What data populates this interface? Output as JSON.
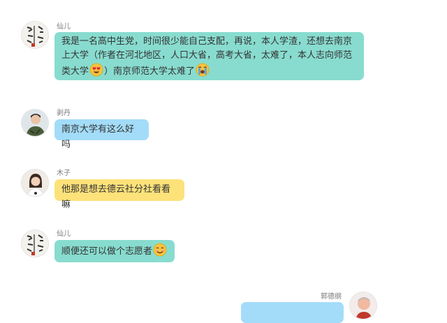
{
  "messages": [
    {
      "user": "仙儿",
      "line1": "我是一名高中生党，时间很少能自己支配，再说，本人学渣，还想去南京",
      "line2": "上大学（作者在河北地区，人口大省，高考大省，太难了，本人志向师范",
      "line3a": "类大学",
      "line3b": "）南京师范大学太难了",
      "emoji_a": "heart-eyes-face",
      "emoji_b": "crying-face",
      "color": "#88dccf"
    },
    {
      "user": "剥丹",
      "text": "南京大学有这么好吗",
      "color": "#a3dcf9"
    },
    {
      "user": "木子",
      "text": "他那是想去德云社分社看看嘛",
      "color": "#fde27a"
    },
    {
      "user": "仙儿",
      "text": "顺便还可以做个志愿者",
      "emoji": "smiling-face",
      "color": "#88dccf"
    },
    {
      "user": "郭德纲",
      "text": "",
      "color": "#a3dcf9"
    }
  ]
}
